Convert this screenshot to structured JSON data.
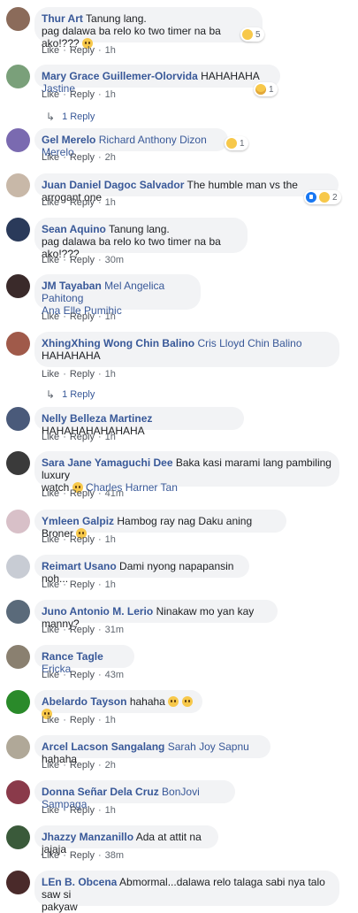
{
  "labels": {
    "like": "Like",
    "reply": "Reply",
    "dot": "·"
  },
  "comments": [
    {
      "author": "Thur Art",
      "text": "Tanung lang.",
      "line2": "pag dalawa ba relo ko two timer na ba ako!???",
      "time": "1h",
      "reactions": "5",
      "avatar": "#8b6b5a"
    },
    {
      "author": "Mary Grace Guillemer-Olorvida",
      "text": "HAHAHAHA",
      "tag": "Jastine",
      "time": "1h",
      "reactions": "1",
      "avatar": "#7aa07a",
      "replies": "1 Reply"
    },
    {
      "author": "Gel Merelo",
      "tag": "Richard Anthony Dizon Merelo",
      "time": "2h",
      "reactions": "1",
      "avatar": "#7a6ab0"
    },
    {
      "author": "Juan Daniel Dagoc Salvador",
      "text": "The humble man vs the arrogant one",
      "time": "1h",
      "reactions": "2",
      "avatar": "#c8b8a8"
    },
    {
      "author": "Sean Aquino",
      "text": "Tanung lang.",
      "line2": "pag dalawa ba relo ko two timer na ba ako!???",
      "time": "30m",
      "avatar": "#2a3a5a"
    },
    {
      "author": "JM Tayaban",
      "tag": "Mel Angelica Pahitong",
      "tag2": "Ana Elle Pumihic",
      "time": "1h",
      "avatar": "#3a2a2a"
    },
    {
      "author": "XhingXhing Wong Chin Balino",
      "tag": "Cris Lloyd Chin Balino",
      "line2": "HAHAHAHA",
      "time": "1h",
      "avatar": "#a05a4a",
      "replies": "1 Reply"
    },
    {
      "author": "Nelly Belleza Martinez",
      "text": "HAHAHAHAHAHAHA",
      "time": "1h",
      "avatar": "#4a5a7a"
    },
    {
      "author": "Sara Jane Yamaguchi Dee",
      "text": "Baka kasi marami lang pambiling luxury",
      "line2": "watch",
      "tag2": "Charles Harner Tan",
      "time": "41m",
      "avatar": "#3a3a3a"
    },
    {
      "author": "Ymleen Galpiz",
      "text": "Hambog ray nag Daku aning Broner",
      "time": "1h",
      "avatar": "#d8c0c8"
    },
    {
      "author": "Reimart Usano",
      "text": "Dami nyong napapansin noh...",
      "time": "1h",
      "avatar": "#c8ccd4"
    },
    {
      "author": "Juno Antonio M. Lerio",
      "text": "Ninakaw mo yan kay manny?",
      "time": "31m",
      "avatar": "#5a6a7a"
    },
    {
      "author": "Rance Tagle",
      "tag": "Ericka",
      "time": "43m",
      "avatar": "#8a8070"
    },
    {
      "author": "Abelardo Tayson",
      "text": "hahaha",
      "time": "1h",
      "avatar": "#2a8a2a"
    },
    {
      "author": "Arcel Lacson Sangalang",
      "tag": "Sarah Joy Sapnu",
      "text": "hahaha",
      "time": "2h",
      "avatar": "#b0a898"
    },
    {
      "author": "Donna Señar Dela Cruz",
      "tag": "BonJovi Sampaga",
      "time": "1h",
      "avatar": "#8a3a4a"
    },
    {
      "author": "Jhazzy Manzanillo",
      "text": "Ada at attit na jajaja",
      "time": "38m",
      "avatar": "#3a5a3a"
    },
    {
      "author": "LEn B. Obcena",
      "text": "Abmormal...dalawa relo talaga sabi nya talo saw si",
      "line2": "pakyaw",
      "avatar": "#4a2a2a"
    }
  ]
}
